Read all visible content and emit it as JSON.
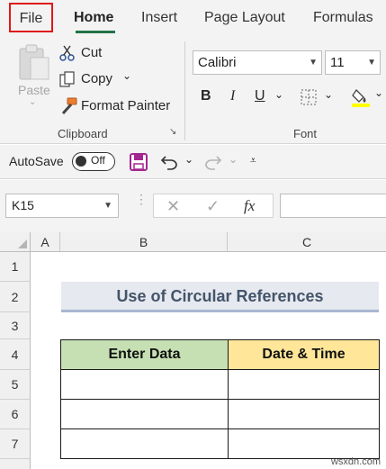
{
  "tabs": {
    "file": "File",
    "home": "Home",
    "insert": "Insert",
    "page_layout": "Page Layout",
    "formulas": "Formulas"
  },
  "clipboard": {
    "paste": "Paste",
    "cut": "Cut",
    "copy": "Copy",
    "format_painter": "Format Painter",
    "group_label": "Clipboard"
  },
  "font": {
    "family": "Calibri",
    "size": "11",
    "bold": "B",
    "italic": "I",
    "underline": "U",
    "group_label": "Font",
    "fill_color": "#ffff00"
  },
  "qat": {
    "autosave_label": "AutoSave",
    "autosave_state": "Off"
  },
  "formula_bar": {
    "name_box": "K15",
    "fx": "fx",
    "formula": ""
  },
  "grid": {
    "columns": [
      "A",
      "B",
      "C"
    ],
    "rows": [
      "1",
      "2",
      "3",
      "4",
      "5",
      "6",
      "7"
    ],
    "title": "Use of Circular References",
    "headers": [
      "Enter Data",
      "Date & Time"
    ],
    "data_rows": [
      [
        "",
        ""
      ],
      [
        "",
        ""
      ],
      [
        "",
        ""
      ]
    ]
  },
  "watermark": "wsxdn.com",
  "colors": {
    "accent": "#217346",
    "file_border": "#e01919",
    "header_green": "#c6e0b4",
    "header_yellow": "#ffe699",
    "title_fill": "#e6e9ef",
    "title_text": "#44546a"
  }
}
